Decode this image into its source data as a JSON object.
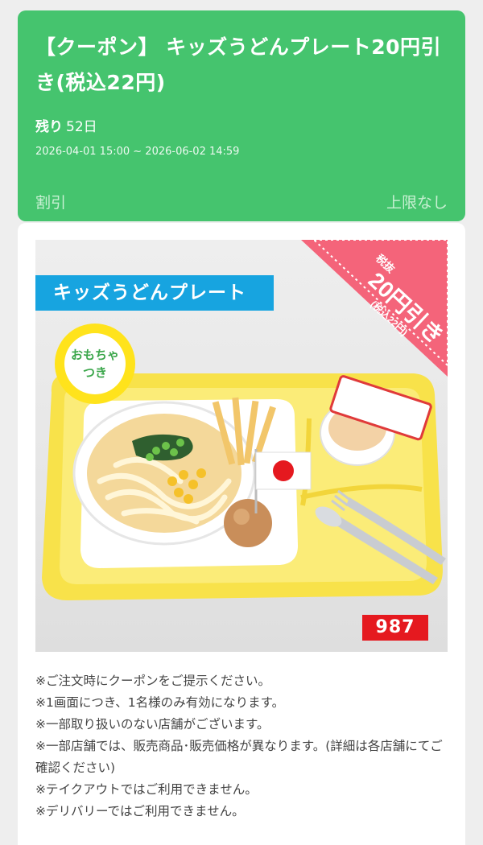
{
  "coupon": {
    "title": "【クーポン】 キッズうどんプレート20円引き(税込22円)",
    "remaining_label": "残り",
    "remaining_value": "52日",
    "period": "2026-04-01 15:00 ~ 2026-06-02 14:59",
    "discount_label": "割引",
    "limit_label": "上限なし"
  },
  "visual": {
    "ribbon_text": "キッズうどんプレート",
    "seal_line1": "おもちゃ",
    "seal_line2": "つき",
    "corner_small": "税抜",
    "corner_big": "20円引き",
    "corner_sub": "(税込22円)",
    "price_code": "987"
  },
  "notes": [
    "※ご注文時にクーポンをご提示ください。",
    "※1画面につき、1名様のみ有効になります。",
    "※一部取り扱いのない店舗がございます。",
    "※一部店舗では、販売商品･販売価格が異なります。(詳細は各店舗にてご確認ください)",
    "※テイクアウトではご利用できません。",
    "※デリバリーではご利用できません。"
  ],
  "colors": {
    "header_green": "#45c46e",
    "ribbon_blue": "#17a4e0",
    "corner_pink": "#f4647a",
    "tray_yellow": "#f8e24a",
    "price_red": "#e5191f"
  }
}
